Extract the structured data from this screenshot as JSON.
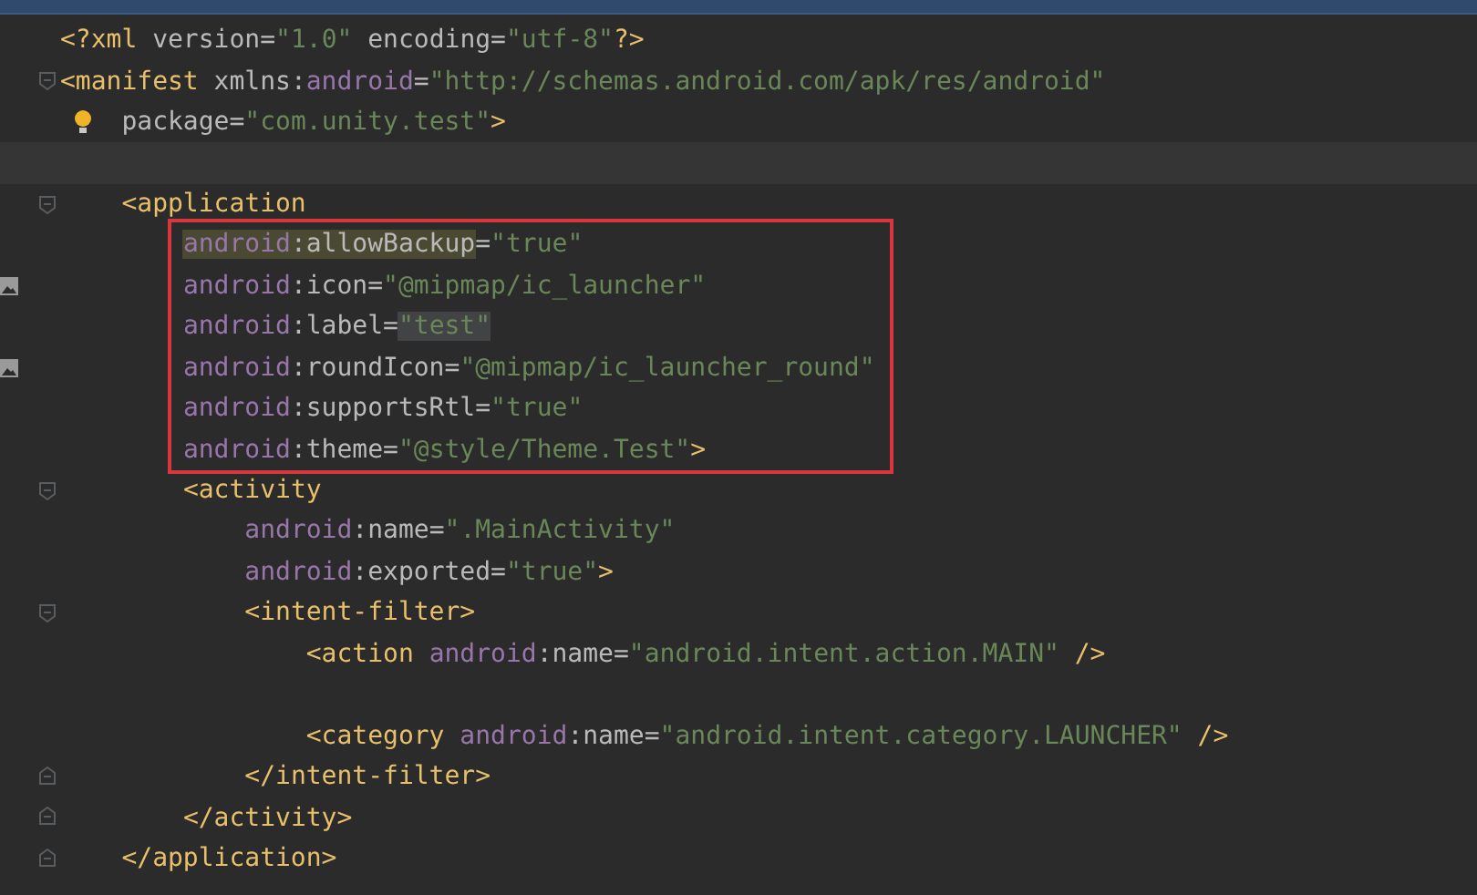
{
  "notification_bar": {
    "visible": true
  },
  "editor": {
    "lines": [
      {
        "kind": "code",
        "fold_start": false,
        "fold_end": false,
        "image_icon": false,
        "bulb": false,
        "segments": [
          {
            "tag": "<?xml "
          },
          {
            "attr": "version"
          },
          {
            "punct": "="
          },
          {
            "str": "\"1.0\""
          },
          {
            "attr": " encoding"
          },
          {
            "punct": "="
          },
          {
            "str": "\"utf-8\""
          },
          {
            "tag": "?>"
          }
        ]
      },
      {
        "kind": "code",
        "fold_start": true,
        "fold_end": false,
        "image_icon": false,
        "bulb": false,
        "segments": [
          {
            "tag": "<manifest "
          },
          {
            "attr": "xmlns:"
          },
          {
            "ns": "android"
          },
          {
            "punct": "="
          },
          {
            "str": "\"http://schemas.android.com/apk/res/android\""
          }
        ]
      },
      {
        "kind": "code",
        "fold_start": false,
        "fold_end": false,
        "image_icon": false,
        "bulb": true,
        "segments": [
          {
            "attr": "    package"
          },
          {
            "punct": "="
          },
          {
            "str": "\"com.unity.test\""
          },
          {
            "tag": ">"
          }
        ]
      },
      {
        "kind": "current"
      },
      {
        "kind": "code",
        "fold_start": true,
        "fold_end": false,
        "image_icon": false,
        "bulb": false,
        "segments": [
          {
            "tag": "    <application"
          }
        ]
      },
      {
        "kind": "frame",
        "lines": [
          {
            "kind": "code",
            "fold_start": false,
            "fold_end": false,
            "image_icon": false,
            "bulb": false,
            "segments": [
              {
                "ns_selected": "        android"
              },
              {
                "attr_selected": ":allowBackup"
              },
              {
                "punct": "="
              },
              {
                "str": "\"true\""
              }
            ]
          },
          {
            "kind": "code",
            "fold_start": false,
            "fold_end": false,
            "image_icon": true,
            "bulb": false,
            "segments": [
              {
                "ns": "        android"
              },
              {
                "attr": ":icon"
              },
              {
                "punct": "="
              },
              {
                "str": "\"@mipmap/ic_launcher\""
              }
            ]
          },
          {
            "kind": "code",
            "fold_start": false,
            "fold_end": false,
            "image_icon": false,
            "bulb": false,
            "segments": [
              {
                "ns": "        android"
              },
              {
                "attr": ":label"
              },
              {
                "punct": "="
              },
              {
                "str_match": "\"test\""
              }
            ]
          },
          {
            "kind": "code",
            "fold_start": false,
            "fold_end": false,
            "image_icon": true,
            "bulb": false,
            "segments": [
              {
                "ns": "        android"
              },
              {
                "attr": ":roundIcon"
              },
              {
                "punct": "="
              },
              {
                "str": "\"@mipmap/ic_launcher_round\""
              }
            ]
          },
          {
            "kind": "code",
            "fold_start": false,
            "fold_end": false,
            "image_icon": false,
            "bulb": false,
            "segments": [
              {
                "ns": "        android"
              },
              {
                "attr": ":supportsRtl"
              },
              {
                "punct": "="
              },
              {
                "str": "\"true\""
              }
            ]
          },
          {
            "kind": "code",
            "fold_start": false,
            "fold_end": false,
            "image_icon": false,
            "bulb": false,
            "segments": [
              {
                "ns": "        android"
              },
              {
                "attr": ":theme"
              },
              {
                "punct": "="
              },
              {
                "str": "\"@style/Theme.Test\""
              },
              {
                "tag": ">"
              }
            ]
          }
        ]
      },
      {
        "kind": "code",
        "fold_start": true,
        "fold_end": false,
        "image_icon": false,
        "bulb": false,
        "segments": [
          {
            "tag": "        <activity"
          }
        ]
      },
      {
        "kind": "code",
        "fold_start": false,
        "fold_end": false,
        "image_icon": false,
        "bulb": false,
        "segments": [
          {
            "ns": "            android"
          },
          {
            "attr": ":name"
          },
          {
            "punct": "="
          },
          {
            "str": "\".MainActivity\""
          }
        ]
      },
      {
        "kind": "code",
        "fold_start": false,
        "fold_end": false,
        "image_icon": false,
        "bulb": false,
        "segments": [
          {
            "ns": "            android"
          },
          {
            "attr": ":exported"
          },
          {
            "punct": "="
          },
          {
            "str": "\"true\""
          },
          {
            "tag": ">"
          }
        ]
      },
      {
        "kind": "code",
        "fold_start": true,
        "fold_end": false,
        "image_icon": false,
        "bulb": false,
        "segments": [
          {
            "tag": "            <intent-filter>"
          }
        ]
      },
      {
        "kind": "code",
        "fold_start": false,
        "fold_end": false,
        "image_icon": false,
        "bulb": false,
        "segments": [
          {
            "tag": "                <action "
          },
          {
            "ns": "android"
          },
          {
            "attr": ":name"
          },
          {
            "punct": "="
          },
          {
            "str": "\"android.intent.action.MAIN\""
          },
          {
            "tag": " />"
          }
        ]
      },
      {
        "kind": "blank"
      },
      {
        "kind": "code",
        "fold_start": false,
        "fold_end": false,
        "image_icon": false,
        "bulb": false,
        "segments": [
          {
            "tag": "                <category "
          },
          {
            "ns": "android"
          },
          {
            "attr": ":name"
          },
          {
            "punct": "="
          },
          {
            "str": "\"android.intent.category.LAUNCHER\""
          },
          {
            "tag": " />"
          }
        ]
      },
      {
        "kind": "code",
        "fold_start": false,
        "fold_end": true,
        "image_icon": false,
        "bulb": false,
        "segments": [
          {
            "tag": "            </intent-filter>"
          }
        ]
      },
      {
        "kind": "code",
        "fold_start": false,
        "fold_end": true,
        "image_icon": false,
        "bulb": false,
        "segments": [
          {
            "tag": "        </activity>"
          }
        ]
      },
      {
        "kind": "code",
        "fold_start": false,
        "fold_end": true,
        "image_icon": false,
        "bulb": false,
        "segments": [
          {
            "tag": "    </application>"
          }
        ]
      }
    ]
  }
}
